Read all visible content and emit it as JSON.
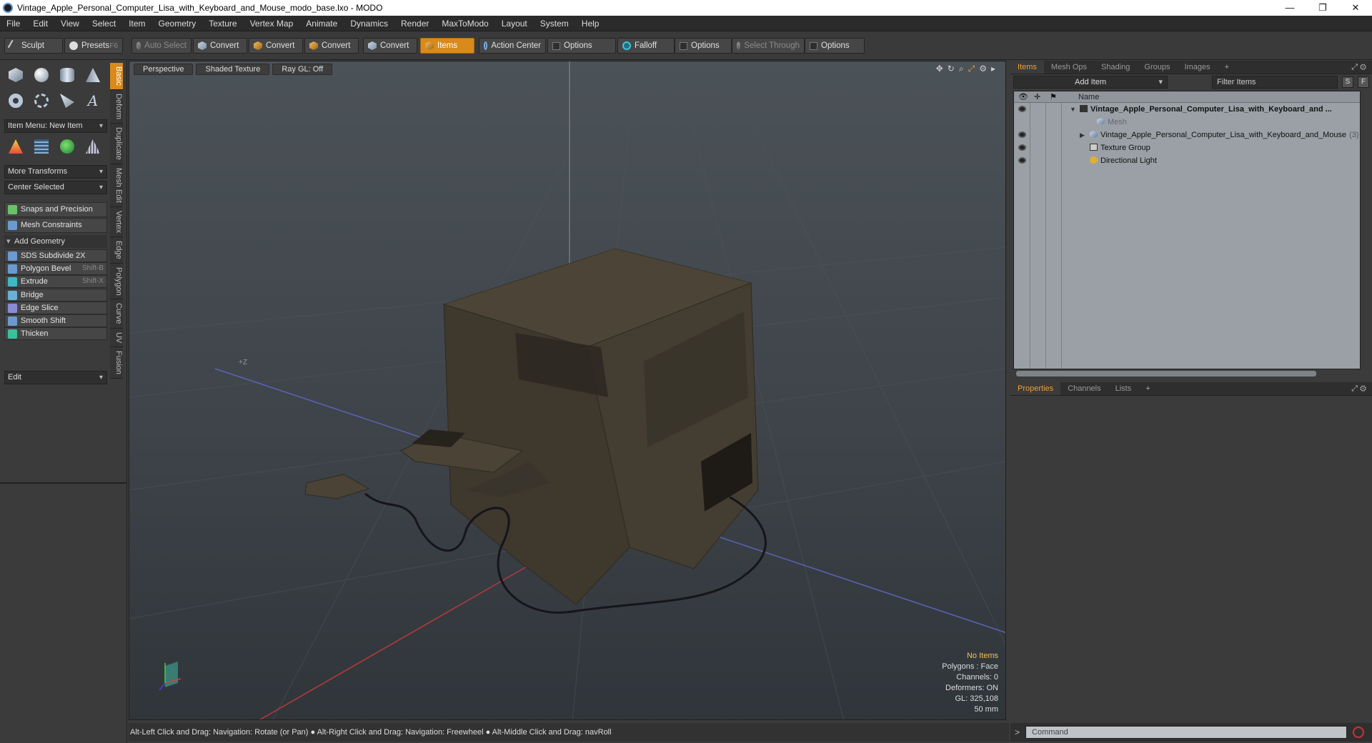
{
  "window": {
    "title": "Vintage_Apple_Personal_Computer_Lisa_with_Keyboard_and_Mouse_modo_base.lxo - MODO",
    "minimize": "—",
    "restore": "❐",
    "close": "✕"
  },
  "menu": [
    "File",
    "Edit",
    "View",
    "Select",
    "Item",
    "Geometry",
    "Texture",
    "Vertex Map",
    "Animate",
    "Dynamics",
    "Render",
    "MaxToModo",
    "Layout",
    "System",
    "Help"
  ],
  "toolbar": {
    "sculpt": "Sculpt",
    "presets": "Presets",
    "presets_key": "F6",
    "auto_select": "Auto Select",
    "convert1": "Convert",
    "convert2": "Convert",
    "convert3": "Convert",
    "convert4": "Convert",
    "items": "Items",
    "action_center": "Action Center",
    "options1": "Options",
    "falloff": "Falloff",
    "options2": "Options",
    "select_through": "Select Through",
    "options3": "Options"
  },
  "left": {
    "item_menu": "Item Menu: New Item",
    "more_transforms": "More Transforms",
    "center_selected": "Center Selected",
    "snaps": "Snaps and Precision",
    "mesh_constraints": "Mesh Constraints",
    "add_geometry": "Add Geometry",
    "tools": [
      {
        "label": "SDS Subdivide 2X",
        "key": "",
        "color": "#6a9ad0"
      },
      {
        "label": "Polygon Bevel",
        "key": "Shift-B",
        "color": "#6a9ad0"
      },
      {
        "label": "Extrude",
        "key": "Shift-X",
        "color": "#3cb8c8"
      },
      {
        "label": "Bridge",
        "key": "",
        "color": "#6ab0d8"
      },
      {
        "label": "Edge Slice",
        "key": "",
        "color": "#8a8ad8"
      },
      {
        "label": "Smooth Shift",
        "key": "",
        "color": "#6a9ad0"
      },
      {
        "label": "Thicken",
        "key": "",
        "color": "#3cc09a"
      }
    ],
    "edit": "Edit",
    "vtabs": [
      "Basic",
      "Deform",
      "Duplicate",
      "Mesh Edit",
      "Vertex",
      "Edge",
      "Polygon",
      "Curve",
      "UV",
      "Fusion"
    ]
  },
  "viewport": {
    "view": "Perspective",
    "shading": "Shaded Texture",
    "raygl": "Ray GL: Off",
    "axis_label": "+Z",
    "stats": {
      "no_items": "No Items",
      "polygons": "Polygons : Face",
      "channels": "Channels: 0",
      "deformers": "Deformers: ON",
      "gl": "GL: 325,108",
      "scale": "50 mm"
    }
  },
  "status": "Alt-Left Click and Drag: Navigation: Rotate (or Pan) ● Alt-Right Click and Drag: Navigation: Freewheel ● Alt-Middle Click and Drag: navRoll",
  "right": {
    "tabs": [
      "Items",
      "Mesh Ops",
      "Shading",
      "Groups",
      "Images"
    ],
    "add_item": "Add Item",
    "filter": "Filter Items",
    "s": "S",
    "f": "F",
    "name_col": "Name",
    "tree": [
      {
        "label": "Vintage_Apple_Personal_Computer_Lisa_with_Keyboard_and ...",
        "count": "",
        "indent": 0,
        "bold": true
      },
      {
        "label": "Mesh",
        "count": "",
        "indent": 1,
        "bold": false
      },
      {
        "label": "Vintage_Apple_Personal_Computer_Lisa_with_Keyboard_and_Mouse",
        "count": "(3)",
        "indent": 1,
        "bold": false
      },
      {
        "label": "Texture Group",
        "count": "",
        "indent": 1,
        "bold": false
      },
      {
        "label": "Directional Light",
        "count": "",
        "indent": 1,
        "bold": false
      }
    ],
    "prop_tabs": [
      "Properties",
      "Channels",
      "Lists"
    ],
    "command": "Command"
  }
}
